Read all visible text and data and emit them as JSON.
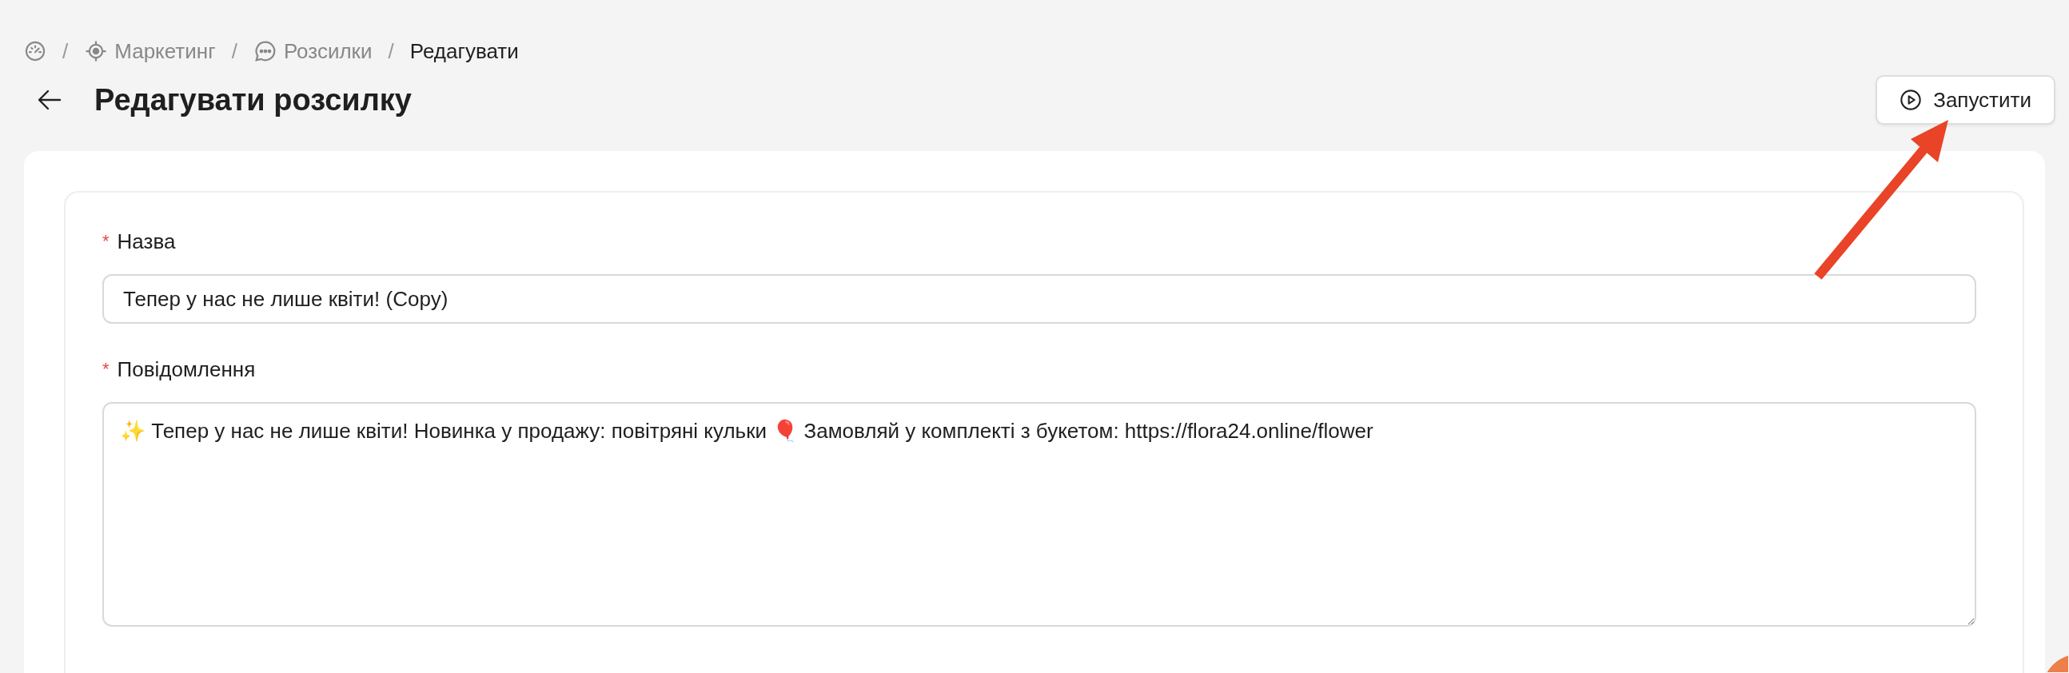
{
  "breadcrumb": [
    {
      "kind": "dashboard",
      "current": false
    },
    {
      "kind": "target",
      "separator": "/",
      "label": "Маркетинг",
      "current": false
    },
    {
      "kind": "chat",
      "separator": "/",
      "label": "Розсилки",
      "current": false
    },
    {
      "kind": "plain",
      "separator": "/",
      "label": "Редагувати",
      "current": true
    }
  ],
  "header": {
    "title": "Редагувати розсилку",
    "action": "Запустити"
  },
  "fields": [
    {
      "kind": "input",
      "marker": "*",
      "label": "Назва",
      "value": "Тепер у нас не лише квіти! (Copy)"
    },
    {
      "kind": "textarea",
      "marker": "*",
      "label": "Повідомлення",
      "value": "✨ Тепер у нас не лише квіти! Новинка у продажу: повітряні кульки 🎈 Замовляй у комплекті з букетом: https://flora24.online/flower"
    }
  ]
}
